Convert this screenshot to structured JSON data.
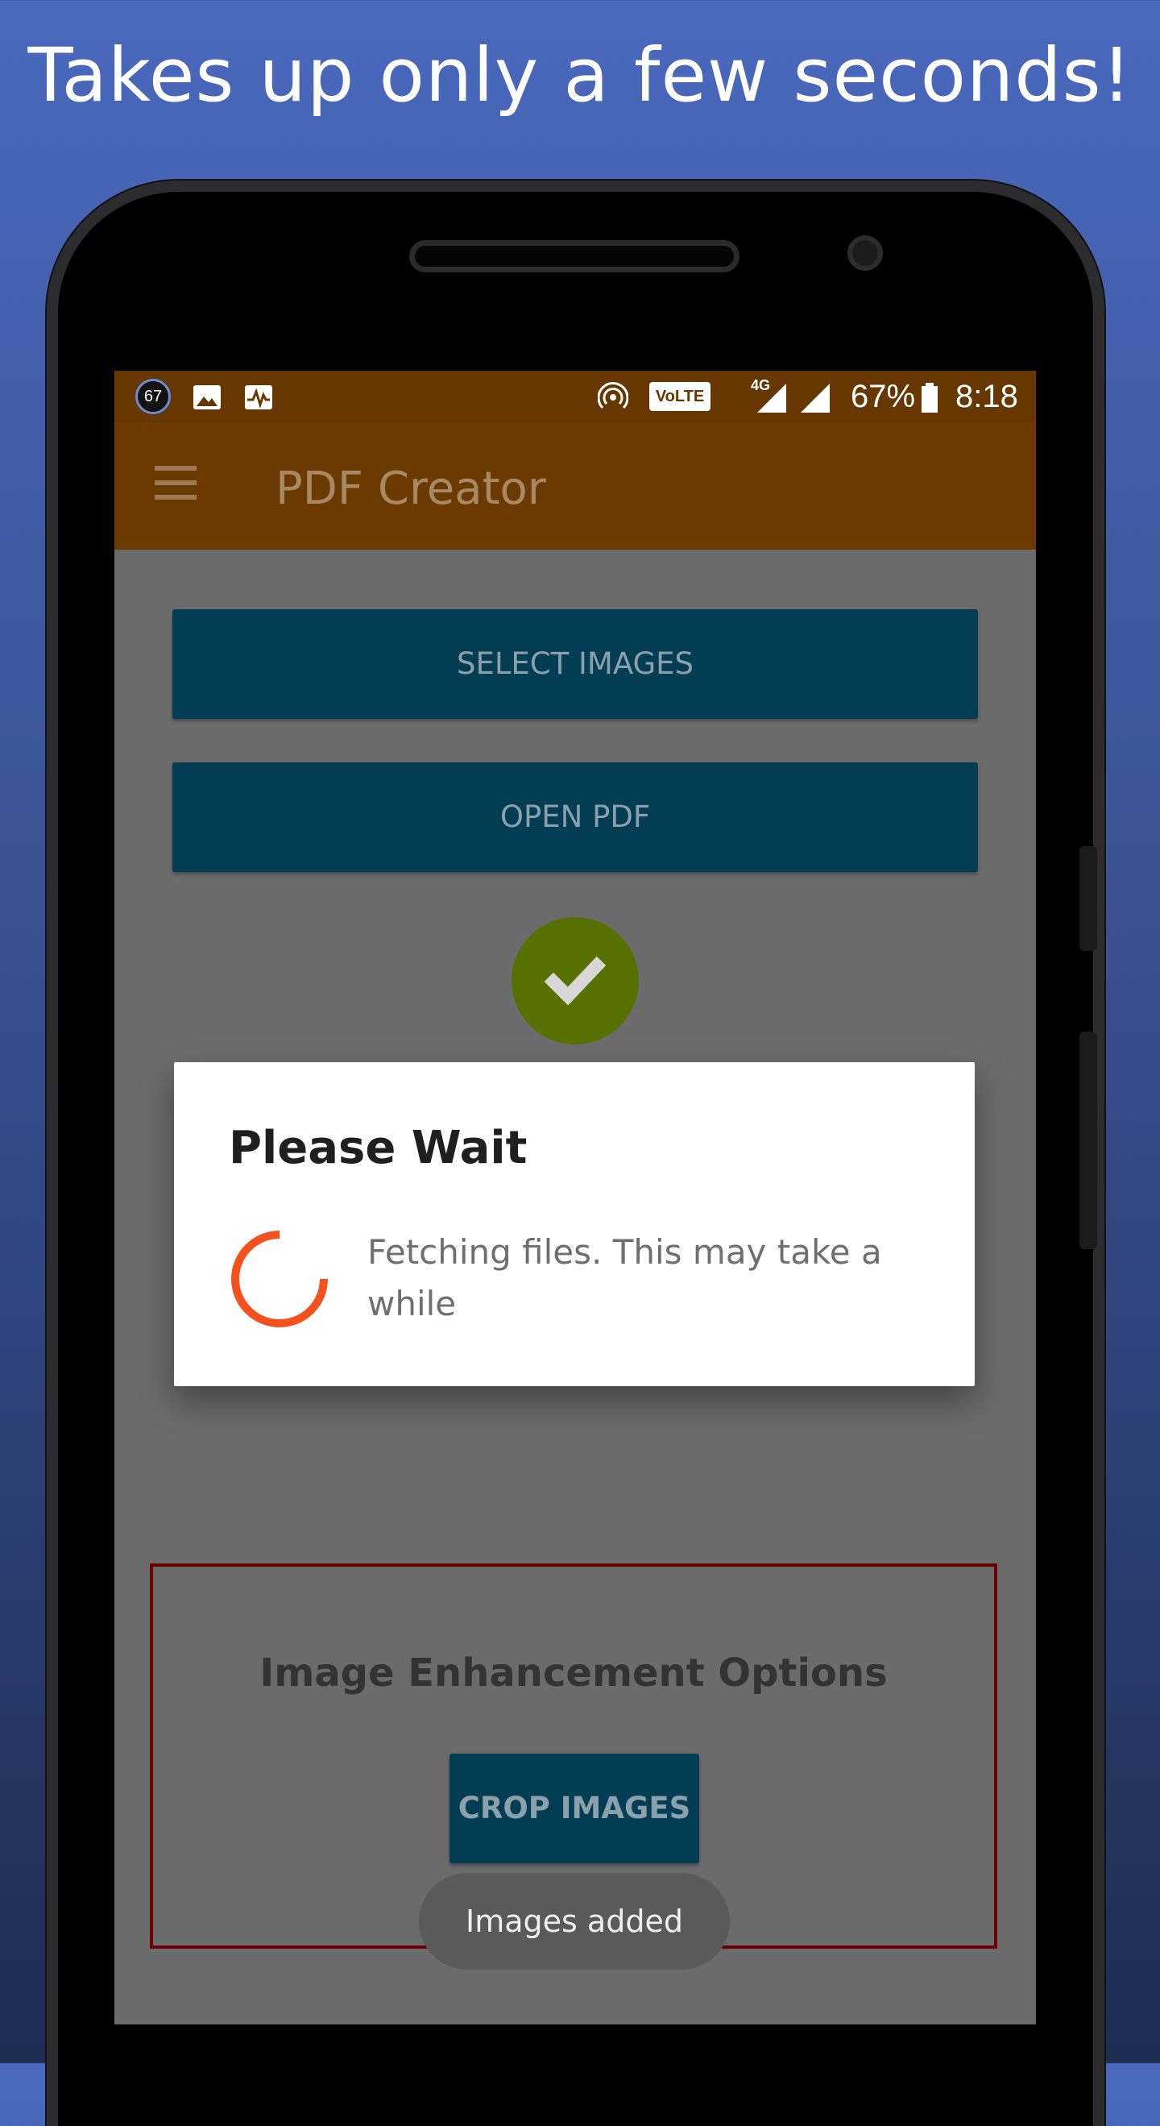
{
  "headline": "Takes up only a few seconds!",
  "status_bar": {
    "notification_badge": "67",
    "battery": "67%",
    "time": "8:18",
    "volte": "VoLTE",
    "network": "4G"
  },
  "app_bar": {
    "title": "PDF Creator"
  },
  "buttons": {
    "select_images": "SELECT IMAGES",
    "open_pdf": "OPEN PDF",
    "crop_images": "CROP IMAGES"
  },
  "dialog": {
    "title": "Please Wait",
    "message": "Fetching files. This may take a while"
  },
  "enhancement": {
    "title": "Image Enhancement Options"
  },
  "toast": "Images added",
  "colors": {
    "status_bar": "#663700",
    "app_bar": "#6a3a00",
    "button": "#033d54",
    "check_circle": "#567100",
    "spinner": "#f4511e",
    "enhancement_border": "#6b0000"
  },
  "icons": [
    "hamburger-menu-icon",
    "checkmark-icon",
    "image-icon",
    "activity-icon",
    "hotspot-icon",
    "signal-icon",
    "battery-icon"
  ]
}
